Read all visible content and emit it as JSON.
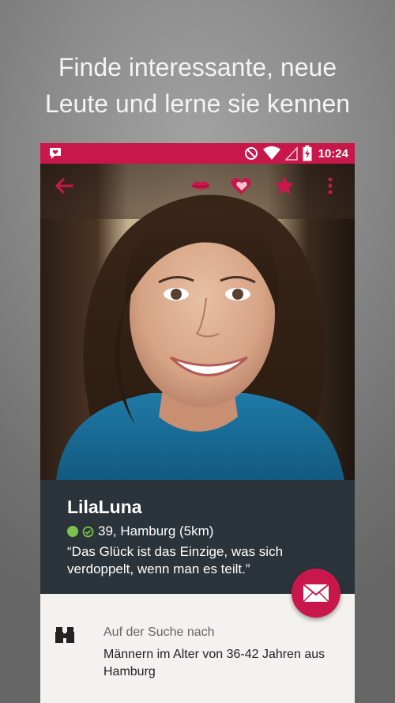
{
  "headline": {
    "line1": "Finde interessante, neue",
    "line2": "Leute und lerne sie kennen"
  },
  "statusbar": {
    "time": "10:24",
    "icons": [
      "app-heart-chat-icon",
      "do-not-disturb-icon",
      "wifi-icon",
      "signal-icon",
      "battery-charging-icon"
    ]
  },
  "toolbar": {
    "icons": [
      "back-arrow-icon",
      "kiss-lips-icon",
      "hearts-icon",
      "star-icon",
      "more-vert-icon"
    ]
  },
  "profile": {
    "name": "LilaLuna",
    "location": "39, Hamburg (5km)",
    "quote_line1": "“Das Glück ist das Einzige, was sich",
    "quote_line2": "verdoppelt, wenn man es teilt.”"
  },
  "search": {
    "label": "Auf der Suche nach",
    "value_line1": "Männern im Alter von 36-42 Jahren aus",
    "value_line2": "Hamburg"
  },
  "colors": {
    "accent": "#c8174b",
    "info_bg": "#2a343a",
    "online": "#7cc24a",
    "page_bg": "#f4f2ee"
  }
}
